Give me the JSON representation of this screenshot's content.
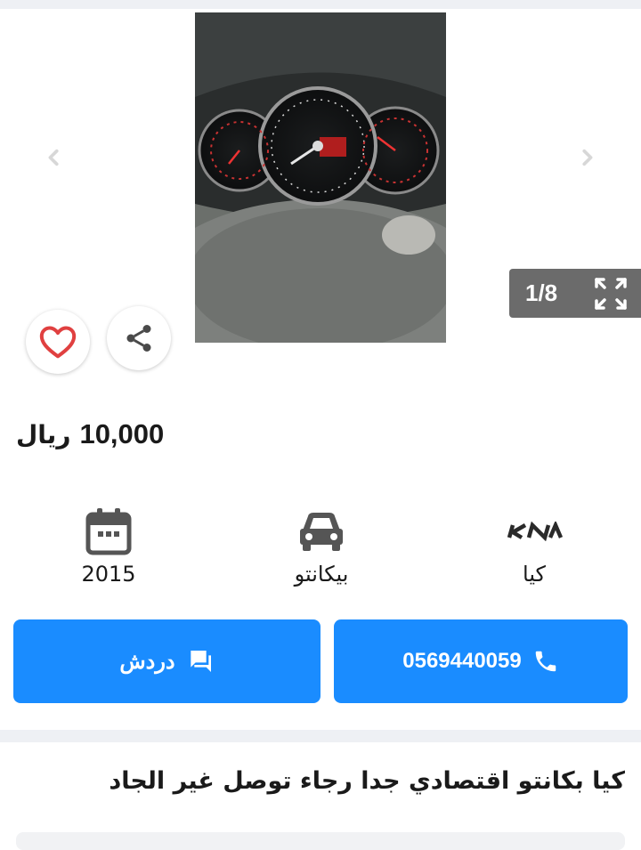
{
  "gallery": {
    "counter_text": "1/8",
    "icons": {
      "prev": "chevron-left-icon",
      "next": "chevron-right-icon",
      "expand": "fullscreen-icon",
      "favorite": "heart-icon",
      "share": "share-icon"
    }
  },
  "price": {
    "amount": "10,000",
    "currency": "ريال"
  },
  "specs": {
    "year": "2015",
    "model": "بيكانتو",
    "make": "كيا",
    "icons": {
      "year": "calendar-icon",
      "model": "car-icon",
      "make": "kia-logo-icon"
    }
  },
  "actions": {
    "chat_label": "دردش",
    "phone_label": "0569440059",
    "colors": {
      "primary": "#1a8cff"
    }
  },
  "listing": {
    "title": "كيا بكانتو اقتصادي جدا رجاء توصل غير الجاد"
  }
}
